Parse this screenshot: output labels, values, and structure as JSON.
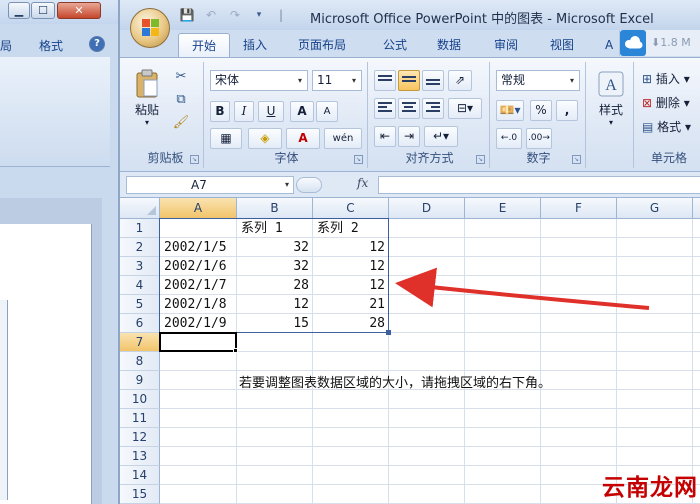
{
  "ppt_window": {
    "tabs": [
      "局",
      "格式"
    ],
    "help_icon": "help-icon",
    "controls": [
      "minimize-icon",
      "maximize-icon",
      "close-icon"
    ]
  },
  "excel_window": {
    "title": "Microsoft Office PowerPoint 中的图表 - Microsoft Excel",
    "tabs": [
      "开始",
      "插入",
      "页面布局",
      "公式",
      "数据",
      "审阅",
      "视图",
      "A"
    ],
    "active_tab": "开始",
    "cloud_badge": "1.8 M",
    "quick_access": [
      "save-icon",
      "undo-icon",
      "redo-icon",
      "customize-icon"
    ]
  },
  "ribbon": {
    "clipboard": {
      "paste": "粘贴",
      "label": "剪贴板"
    },
    "font": {
      "name": "宋体",
      "size": "11",
      "bold": "B",
      "italic": "I",
      "underline": "U",
      "grow": "A",
      "shrink": "A",
      "phonetic": "wén",
      "label": "字体"
    },
    "alignment": {
      "label": "对齐方式"
    },
    "number": {
      "format": "常规",
      "percent": "%",
      "comma": ",",
      "label": "数字"
    },
    "styles": {
      "label": "样式"
    },
    "cells": {
      "insert": "插入",
      "delete": "删除",
      "format": "格式",
      "label": "单元格"
    }
  },
  "formula_bar": {
    "name_box": "A7",
    "fx": "fx",
    "value": ""
  },
  "sheet": {
    "columns": [
      "A",
      "B",
      "C",
      "D",
      "E",
      "F",
      "G"
    ],
    "rows": [
      "1",
      "2",
      "3",
      "4",
      "5",
      "6",
      "7",
      "8",
      "9",
      "10",
      "11",
      "12",
      "13",
      "14",
      "15"
    ],
    "selected_column": "A",
    "selected_row": "7",
    "header_row": [
      "",
      "系列 1",
      "系列 2"
    ],
    "data": [
      [
        "2002/1/5",
        "32",
        "12"
      ],
      [
        "2002/1/6",
        "32",
        "12"
      ],
      [
        "2002/1/7",
        "28",
        "12"
      ],
      [
        "2002/1/8",
        "12",
        "21"
      ],
      [
        "2002/1/9",
        "15",
        "28"
      ]
    ],
    "note": "若要调整图表数据区域的大小，请拖拽区域的右下角。"
  },
  "colors": {
    "arrow": "#e0302a",
    "range_border": "#3c5f9e",
    "selected_header": "#f2c46a"
  },
  "watermark": "云南龙网"
}
